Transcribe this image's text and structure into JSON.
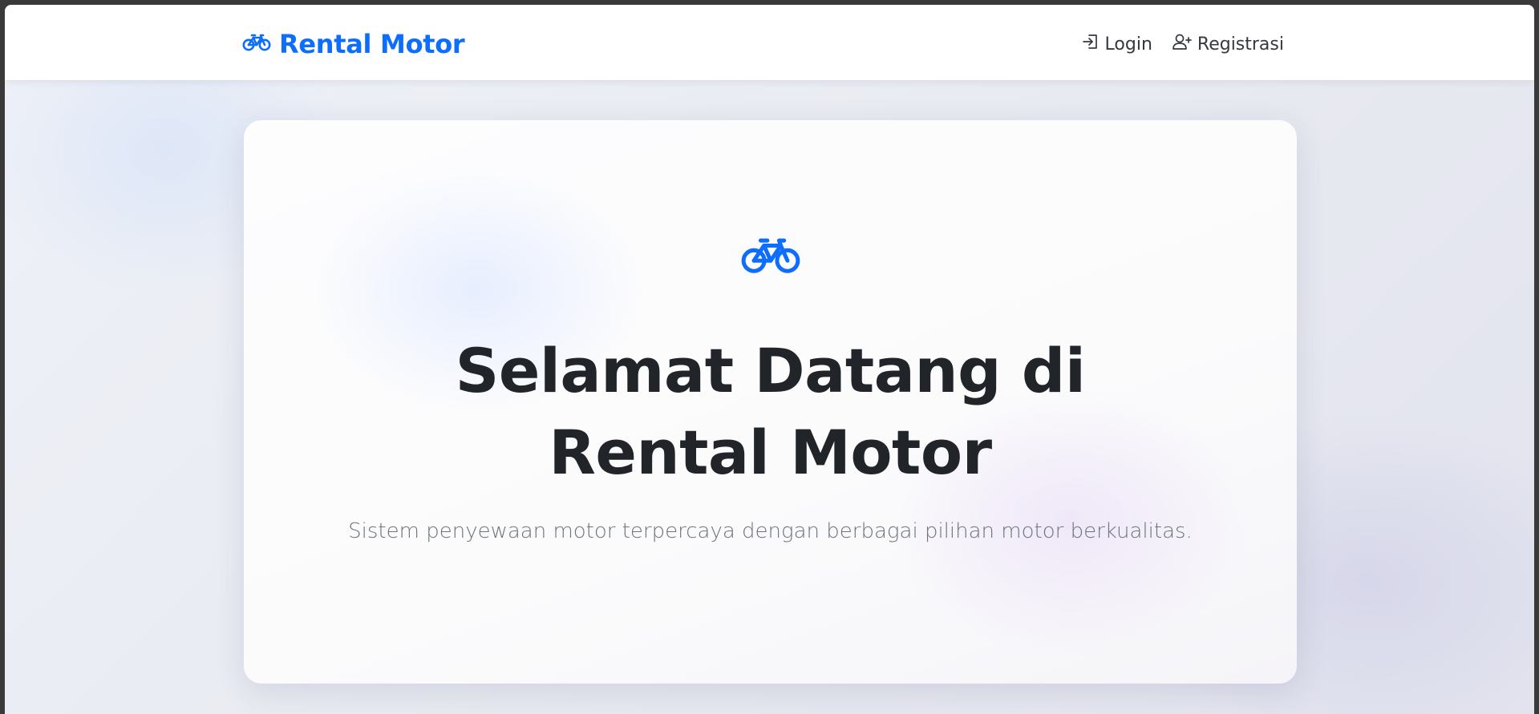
{
  "navbar": {
    "brand": {
      "icon": "bicycle-icon",
      "label": "Rental Motor"
    },
    "links": [
      {
        "icon": "login-icon",
        "label": "Login"
      },
      {
        "icon": "person-add-icon",
        "label": "Registrasi"
      }
    ]
  },
  "hero": {
    "icon": "bicycle-icon",
    "title": "Selamat Datang di Rental Motor",
    "subtitle": "Sistem penyewaan motor terpercaya dengan berbagai pilihan motor berkualitas."
  },
  "colors": {
    "accent": "#0d6efd",
    "heading": "#212529",
    "muted": "#6c757d",
    "navbar_bg": "#ffffff"
  }
}
